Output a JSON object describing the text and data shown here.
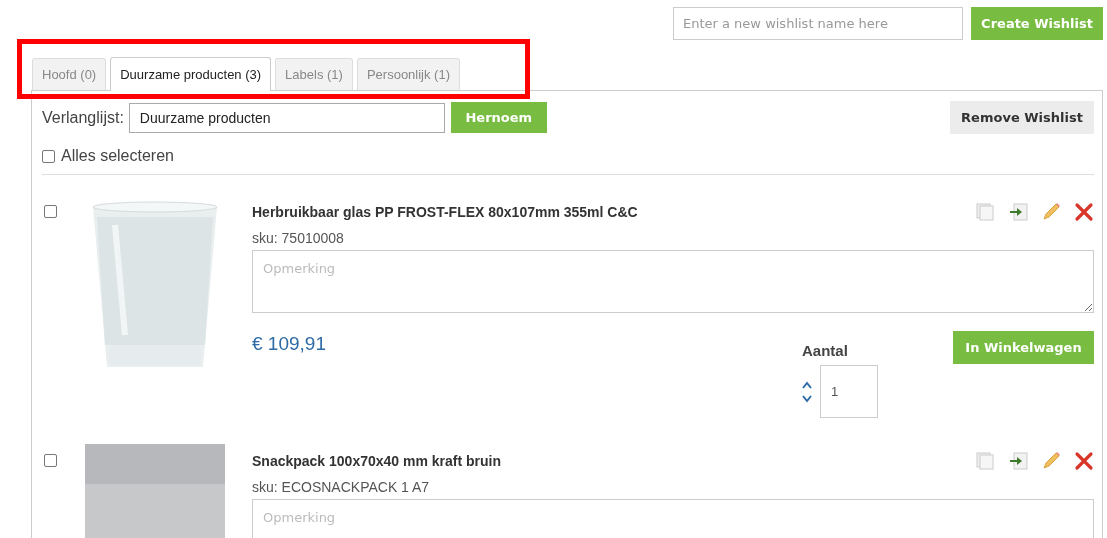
{
  "new_wishlist": {
    "placeholder": "Enter a new wishlist name here",
    "button": "Create Wishlist"
  },
  "tabs": [
    {
      "label": "Hoofd (0)",
      "selected": false
    },
    {
      "label": "Duurzame producten (3)",
      "selected": true
    },
    {
      "label": "Labels (1)",
      "selected": false
    },
    {
      "label": "Persoonlijk (1)",
      "selected": false
    }
  ],
  "tabs_highlighted": true,
  "wishlist": {
    "label": "Verlanglijst:",
    "name": "Duurzame producten",
    "rename_button": "Hernoem",
    "remove_button": "Remove Wishlist",
    "select_all": {
      "label": "Alles selecteren",
      "checked": false
    }
  },
  "items": [
    {
      "checked": false,
      "title": "Herbruikbaar glas PP FROST-FLEX 80x107mm 355ml C&C",
      "sku": "sku: 75010008",
      "remark_placeholder": "Opmerking",
      "price": "€ 109,91",
      "quantity_label": "Aantal",
      "quantity": "1",
      "cart_button": "In Winkelwagen"
    },
    {
      "checked": false,
      "title": "Snackpack 100x70x40 mm kraft bruin",
      "sku": "sku: ECOSNACKPACK 1 A7",
      "remark_placeholder": "Opmerking"
    }
  ]
}
